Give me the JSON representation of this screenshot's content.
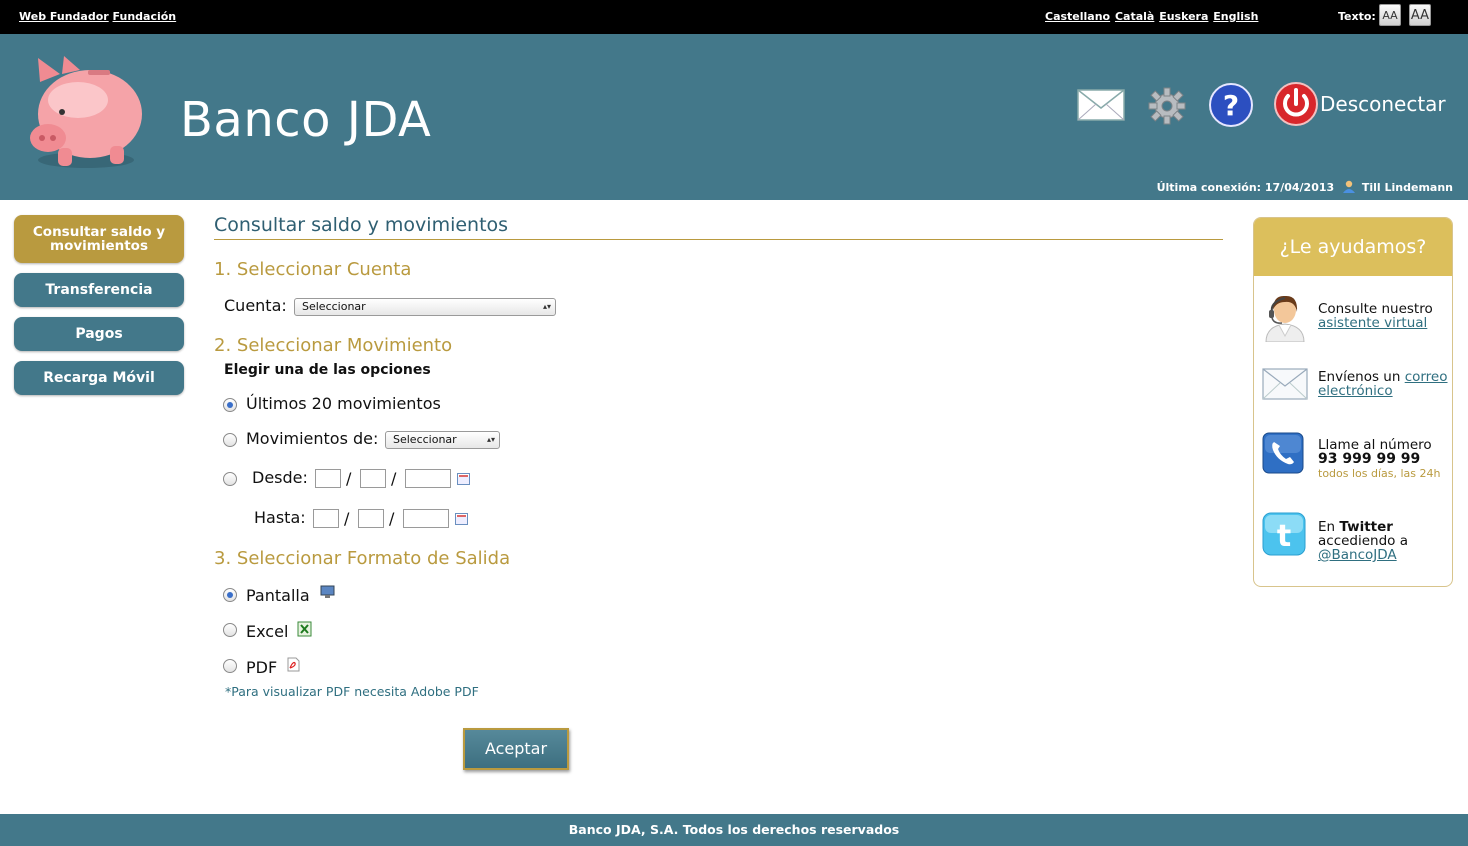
{
  "topbar": {
    "links": [
      "Web Fundador",
      "Fundación"
    ],
    "languages": [
      "Castellano",
      "Català",
      "Euskera",
      "English"
    ],
    "text_label": "Texto:",
    "text_buttons": [
      "AA",
      "AA"
    ]
  },
  "header": {
    "brand": "Banco JDA",
    "disconnect_label": "Desconectar",
    "last_connection": "Última conexión: 17/04/2013",
    "user_name": "Till Lindemann"
  },
  "nav": {
    "items": [
      {
        "label": "Consultar saldo y movimientos",
        "active": true
      },
      {
        "label": "Transferencia",
        "active": false
      },
      {
        "label": "Pagos",
        "active": false
      },
      {
        "label": "Recarga Móvil",
        "active": false
      }
    ]
  },
  "main": {
    "title": "Consultar saldo y movimientos",
    "section1": "1. Seleccionar Cuenta",
    "cuenta_label": "Cuenta:",
    "cuenta_select": "Seleccionar",
    "section2": "2. Seleccionar Movimiento",
    "choose_label": "Elegir una de las opciones",
    "opt_last": "Últimos 20 movimientos",
    "opt_movs": "Movimientos de:",
    "movs_select": "Seleccionar",
    "desde_label": "Desde:",
    "hasta_label": "Hasta:",
    "slash": "/",
    "section3": "3. Seleccionar Formato de Salida",
    "fmt_screen": "Pantalla",
    "fmt_excel": "Excel",
    "fmt_pdf": "PDF",
    "pdf_note": "*Para visualizar PDF necesita Adobe PDF",
    "accept_label": "Aceptar"
  },
  "help": {
    "title": "¿Le ayudamos?",
    "assistant_text": "Consulte nuestro",
    "assistant_link": "asistente virtual",
    "mail_text": "Envíenos un",
    "mail_link_1": "correo",
    "mail_link_2": "electrónico",
    "phone_text": "Llame al número",
    "phone_number": "93 999 99 99",
    "phone_hours": "todos los días, las 24h",
    "twitter_text_1": "En",
    "twitter_text_bold": "Twitter",
    "twitter_text_2": "accediendo a",
    "twitter_link": "@BancoJDA"
  },
  "footer": {
    "text": "Banco JDA, S.A. Todos los derechos reservados"
  },
  "colors": {
    "header_teal": "#43788a",
    "gold": "#b99a3f",
    "help_gold": "#dcbf5c",
    "radio_selected": "#3a6fc9"
  }
}
